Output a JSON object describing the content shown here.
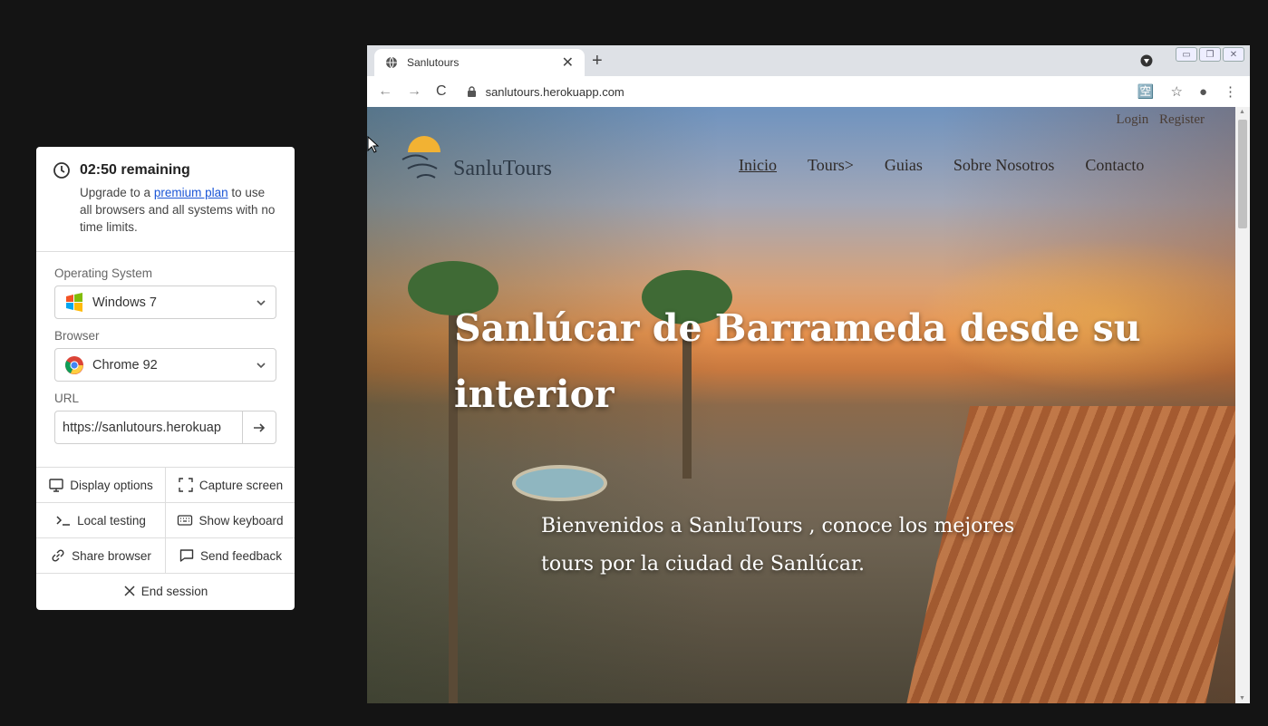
{
  "panel": {
    "timer": "02:50 remaining",
    "upgrade_before": "Upgrade to a ",
    "upgrade_link": "premium plan",
    "upgrade_after": " to use all browsers and all systems with no time limits.",
    "os_label": "Operating System",
    "os_value": "Windows 7",
    "browser_label": "Browser",
    "browser_value": "Chrome 92",
    "url_label": "URL",
    "url_value": "https://sanlutours.herokuap",
    "actions": {
      "display_options": "Display options",
      "capture_screen": "Capture screen",
      "local_testing": "Local testing",
      "show_keyboard": "Show keyboard",
      "share_browser": "Share browser",
      "send_feedback": "Send feedback",
      "end_session": "End session"
    }
  },
  "browser": {
    "tab_title": "Sanlutours",
    "address": "sanlutours.herokuapp.com"
  },
  "site": {
    "login": "Login",
    "register": "Register",
    "logo_text": "SanluTours",
    "menu": [
      "Inicio",
      "Tours>",
      "Guias",
      "Sobre Nosotros",
      "Contacto"
    ],
    "hero_title": "Sanlúcar de Barrameda desde su interior",
    "hero_subtitle": "Bienvenidos a SanluTours , conoce los mejores tours por la ciudad de Sanlúcar."
  }
}
